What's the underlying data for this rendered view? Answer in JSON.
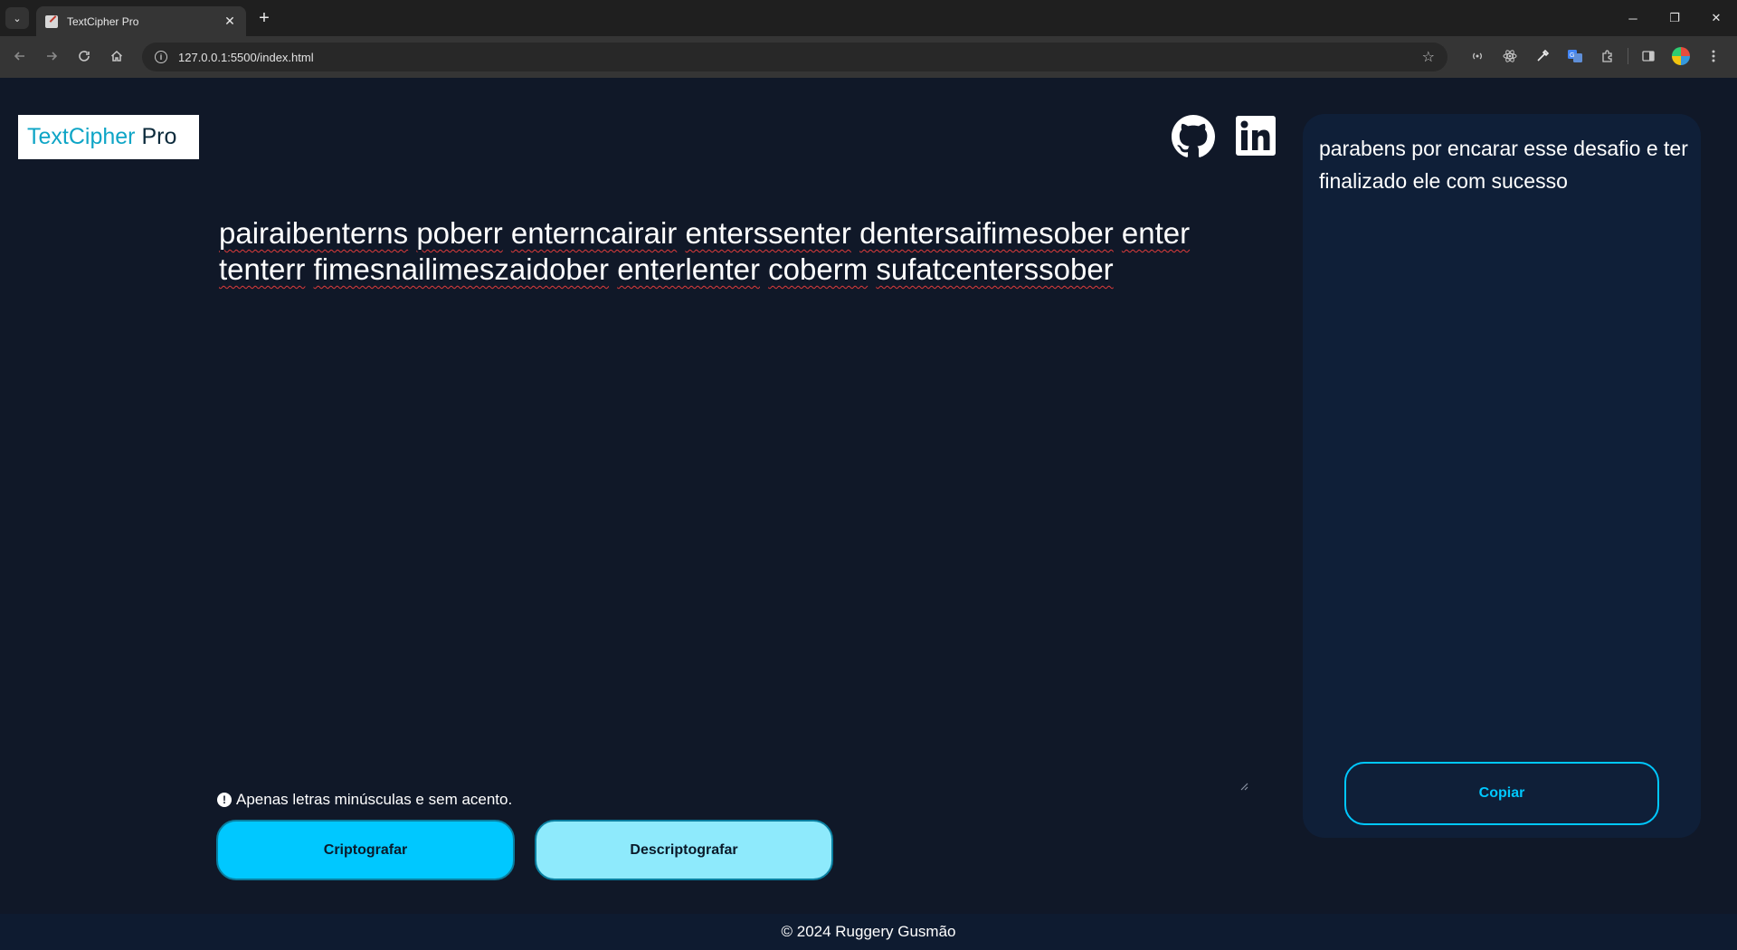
{
  "browser": {
    "tab_title": "TextCipher Pro",
    "tab_close": "✕",
    "new_tab": "+",
    "url": "127.0.0.1:5500/index.html",
    "window_minimize": "─",
    "window_restore": "❐",
    "window_close": "✕"
  },
  "header": {
    "logo_part1": "TextCipher",
    "logo_part2": "Pro"
  },
  "input": {
    "words": [
      "pairaibenterns",
      "poberr",
      "enterncairair",
      "enterssenter",
      "dentersaifimesober",
      "enter",
      "tenterr",
      "fimesnailimeszaidober",
      "enterlenter",
      "coberm",
      "sufatcenterssober"
    ]
  },
  "hint": {
    "icon": "!",
    "text": "Apenas letras minúsculas e sem acento."
  },
  "buttons": {
    "encrypt": "Criptografar",
    "decrypt": "Descriptografar",
    "copy": "Copiar"
  },
  "output": {
    "text": "parabens por encarar esse desafio e ter finalizado ele com sucesso"
  },
  "footer": {
    "text": "© 2024 Ruggery Gusmão"
  },
  "colors": {
    "page_bg": "#101828",
    "panel_bg": "#0f1f38",
    "accent": "#00c8ff",
    "accent_light": "#8eeafc"
  }
}
